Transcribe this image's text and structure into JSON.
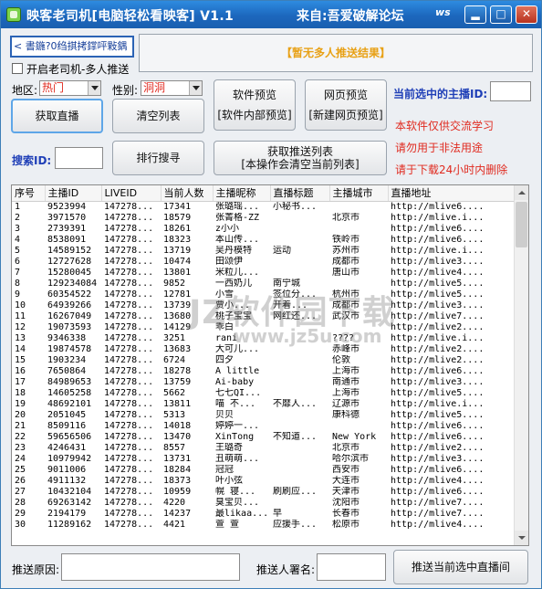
{
  "window": {
    "title": "映客老司机[电脑轻松看映客] V1.1",
    "source": "来自:吾爱破解论坛",
    "badge": "ws"
  },
  "controls": {
    "minimize": "▂",
    "maximize": "□",
    "close": "✕"
  },
  "marquee": "< 書鍦?0绉掑拷鐣呯敤鍝",
  "notice": "【暂无多人推送结果】",
  "checkbox_label": "开启老司机-多人推送",
  "filters": {
    "region_label": "地区:",
    "region_value": "热门",
    "gender_label": "性别:",
    "gender_value": "洞洞"
  },
  "current_host_label": "当前选中的主播ID:",
  "buttons": {
    "get_live": "获取直播",
    "clear_list": "清空列表",
    "software_preview": "软件预览",
    "software_preview_sub": "[软件内部预览]",
    "web_preview": "网页预览",
    "web_preview_sub": "[新建网页预览]",
    "rank_search": "排行搜寻",
    "get_push_list": "获取推送列表",
    "get_push_list_sub": "[本操作会清空当前列表]",
    "push_current": "推送当前选中直播间"
  },
  "search_id_label": "搜索ID:",
  "disclaimers": [
    "本软件仅供交流学习",
    "请勿用于非法用途",
    "请于下载24小时内删除"
  ],
  "table": {
    "columns": [
      "序号",
      "主播ID",
      "LIVEID",
      "当前人数",
      "主播昵称",
      "直播标题",
      "主播城市",
      "直播地址"
    ],
    "rows": [
      [
        "1",
        "9523994",
        "147278...",
        "17341",
        "张璐瑶...",
        "小秘书...",
        "",
        "http://mlive6...."
      ],
      [
        "2",
        "3971570",
        "147278...",
        "18579",
        "张菁格-ZZ",
        "",
        "北京市",
        "http://mlive.i..."
      ],
      [
        "3",
        "2739391",
        "147278...",
        "18261",
        "z小小",
        "",
        "",
        "http://mlive6...."
      ],
      [
        "4",
        "8538091",
        "147278...",
        "18323",
        "本山传...",
        "",
        "铁岭市",
        "http://mlive6...."
      ],
      [
        "5",
        "14589152",
        "147278...",
        "13719",
        "吴丹模特",
        "运动",
        "苏州市",
        "http://mlive.i..."
      ],
      [
        "6",
        "12727628",
        "147278...",
        "10474",
        "田颂伊",
        "",
        "成都市",
        "http://mlive3...."
      ],
      [
        "7",
        "15280045",
        "147278...",
        "13801",
        "米粒儿...",
        "",
        "唐山市",
        "http://mlive4...."
      ],
      [
        "8",
        "129234084",
        "147278...",
        "9852",
        "一西奶儿",
        "南宁城",
        "",
        "http://mlive5...."
      ],
      [
        "9",
        "60354522",
        "147278...",
        "12781",
        "小雪",
        "签位分...",
        "杭州市",
        "http://mlive5...."
      ],
      [
        "10",
        "64939266",
        "147278...",
        "13739",
        "贾小...",
        "开着...",
        "成都市",
        "http://mlive3...."
      ],
      [
        "11",
        "16267049",
        "147278...",
        "13680",
        "桃子宝宝",
        "网红还...",
        "武汉市",
        "http://mlive7...."
      ],
      [
        "12",
        "19073593",
        "147278...",
        "14129",
        "乖白",
        "",
        "",
        "http://mlive2...."
      ],
      [
        "13",
        "9346338",
        "147278...",
        "3251",
        "rani",
        "",
        "????",
        "http://mlive.i..."
      ],
      [
        "14",
        "19874578",
        "147278...",
        "13683",
        "大可儿...",
        "",
        "赤峰市",
        "http://mlive2...."
      ],
      [
        "15",
        "1903234",
        "147278...",
        "6724",
        "四夕",
        "",
        "伦敦",
        "http://mlive2...."
      ],
      [
        "16",
        "7650864",
        "147278...",
        "18278",
        "A little",
        "",
        "上海市",
        "http://mlive6...."
      ],
      [
        "17",
        "84989653",
        "147278...",
        "13759",
        "Ai-baby",
        "",
        "南通市",
        "http://mlive3...."
      ],
      [
        "18",
        "14605258",
        "147278...",
        "5662",
        "七七QI...",
        "",
        "上海市",
        "http://mlive5...."
      ],
      [
        "19",
        "48692101",
        "147278...",
        "13811",
        "喵  不...",
        "不靡人...",
        "辽源市",
        "http://mlive.i..."
      ],
      [
        "20",
        "2051045",
        "147278...",
        "5313",
        "贝贝",
        "",
        "康科德",
        "http://mlive5...."
      ],
      [
        "21",
        "8509116",
        "147278...",
        "14018",
        "婷婷一...",
        "",
        "",
        "http://mlive6...."
      ],
      [
        "22",
        "59656506",
        "147278...",
        "13470",
        "XinTong",
        "不知道...",
        "New York",
        "http://mlive6...."
      ],
      [
        "23",
        "4246431",
        "147278...",
        "8557",
        "王璐奇",
        "",
        "北京市",
        "http://mlive2...."
      ],
      [
        "24",
        "10979942",
        "147278...",
        "13731",
        "丑萌萌...",
        "",
        "哈尔滨市",
        "http://mlive3...."
      ],
      [
        "25",
        "9011006",
        "147278...",
        "18284",
        "冠冠",
        "",
        "西安市",
        "http://mlive6...."
      ],
      [
        "26",
        "4911132",
        "147278...",
        "18373",
        "叶小弦",
        "",
        "大连市",
        "http://mlive4...."
      ],
      [
        "27",
        "10432104",
        "147278...",
        "10959",
        "幌  寝...",
        "刷刷应...",
        "天津市",
        "http://mlive6...."
      ],
      [
        "28",
        "69263142",
        "147278...",
        "4220",
        "臭宝贝...",
        "",
        "沈阳市",
        "http://mlive7...."
      ],
      [
        "29",
        "2194179",
        "147278...",
        "14237",
        "最likaa...",
        "早",
        "长春市",
        "http://mlive7...."
      ],
      [
        "30",
        "11289162",
        "147278...",
        "4421",
        "萱  萱",
        "应援手...",
        "松原市",
        "http://mlive4...."
      ]
    ]
  },
  "footer": {
    "reason_label": "推送原因:",
    "signer_label": "推送人署名:"
  },
  "watermark": {
    "text": "JZ软件园下载",
    "url": "www.jz5u.com"
  }
}
